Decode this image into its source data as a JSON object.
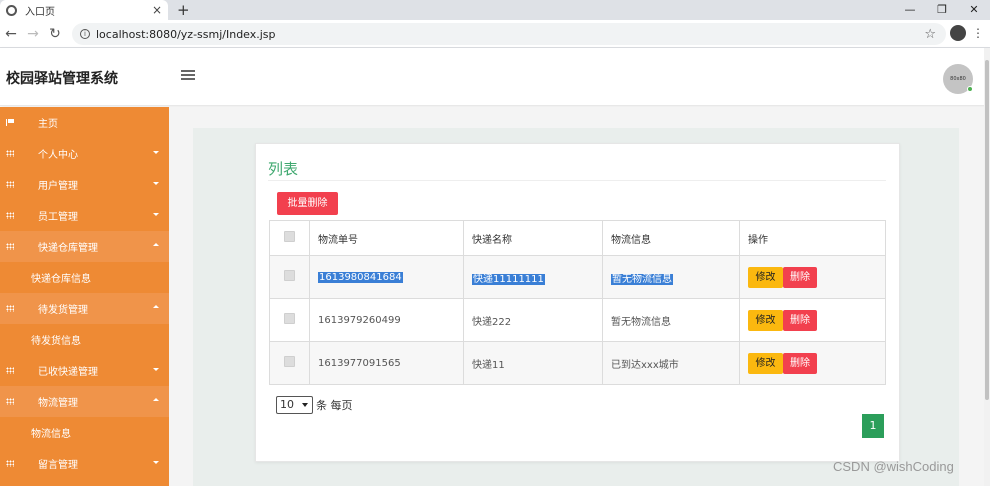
{
  "browser": {
    "tab_title": "入口页",
    "tab_close": "×",
    "new_tab": "+",
    "url": "localhost:8080/yz-ssmj/Index.jsp",
    "window_buttons": [
      "—",
      "❐",
      "✕"
    ],
    "nav_back": "←",
    "nav_forward": "→",
    "nav_reload": "↻",
    "star": "☆",
    "menu": "⋮"
  },
  "header": {
    "title": "校园驿站管理系统",
    "avatar_text": "80x80"
  },
  "sidebar": {
    "items": [
      {
        "label": "主页",
        "icon": "flag-icon",
        "caret": ""
      },
      {
        "label": "个人中心",
        "icon": "grid-icon",
        "caret": "down"
      },
      {
        "label": "用户管理",
        "icon": "grid-icon",
        "caret": "down"
      },
      {
        "label": "员工管理",
        "icon": "grid-icon",
        "caret": "down"
      },
      {
        "label": "快递仓库管理",
        "icon": "grid-icon",
        "caret": "up"
      },
      {
        "label": "快递仓库信息",
        "sub": true
      },
      {
        "label": "待发货管理",
        "icon": "grid-icon",
        "caret": "up"
      },
      {
        "label": "待发货信息",
        "sub": true
      },
      {
        "label": "已收快递管理",
        "icon": "grid-icon",
        "caret": "down"
      },
      {
        "label": "物流管理",
        "icon": "grid-icon",
        "caret": "up"
      },
      {
        "label": "物流信息",
        "sub": true
      },
      {
        "label": "留言管理",
        "icon": "grid-icon",
        "caret": "down"
      }
    ]
  },
  "main": {
    "title": "列表",
    "batch_delete": "批量删除",
    "table": {
      "headers": [
        "物流单号",
        "快递名称",
        "物流信息",
        "操作"
      ],
      "rows": [
        {
          "tracking_no": "1613980841684",
          "name": "快递11111111",
          "info": "暂无物流信息"
        },
        {
          "tracking_no": "1613979260499",
          "name": "快递222",
          "info": "暂无物流信息"
        },
        {
          "tracking_no": "1613977091565",
          "name": "快递11",
          "info": "已到达xxx城市"
        }
      ],
      "edit_label": "修改",
      "delete_label": "删除"
    },
    "page_size": "10",
    "page_size_suffix": "条 每页",
    "current_page": "1"
  },
  "watermark": "CSDN @wishCoding",
  "colors": {
    "sidebar_bg": "#ee8a34",
    "title_green": "#3fa86f",
    "danger": "#f2404e",
    "warning": "#fbb80f",
    "page_green": "#2b9e5a"
  }
}
